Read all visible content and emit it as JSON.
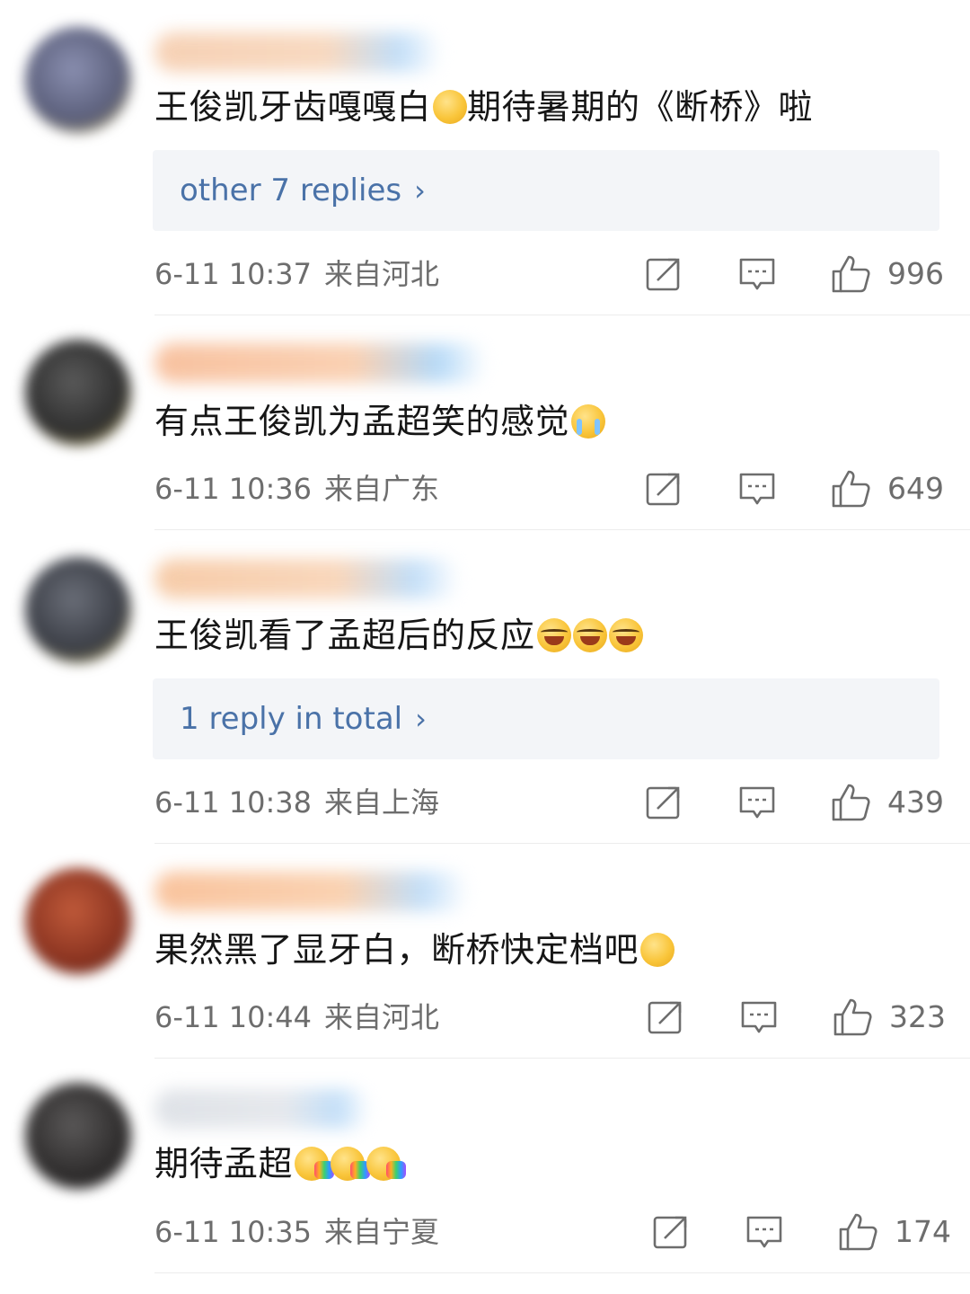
{
  "comments": [
    {
      "text": "王俊凯牙齿嘎嘎白",
      "text_after_emoji": "期待暑期的《断桥》啦",
      "emojis": [
        "thinking-face-emoji"
      ],
      "replies_label": "other 7 replies",
      "date": "6-11 10:37",
      "region": "来自河北",
      "likes": "996",
      "avatar_color": "#6b6f8e",
      "name_color": "#f5c9a8"
    },
    {
      "text": "有点王俊凯为孟超笑的感觉",
      "text_after_emoji": "",
      "emojis": [
        "loudly-crying-face-emoji"
      ],
      "replies_label": "",
      "date": "6-11 10:36",
      "region": "来自广东",
      "likes": "649",
      "avatar_color": "#3f3f3f",
      "name_color": "#f7b78f"
    },
    {
      "text": "王俊凯看了孟超后的反应",
      "text_after_emoji": "",
      "emojis": [
        "laughing-face-emoji",
        "laughing-face-emoji",
        "laughing-face-emoji"
      ],
      "replies_label": "1 reply in total",
      "date": "6-11 10:38",
      "region": "来自上海",
      "likes": "439",
      "avatar_color": "#4a4d55",
      "name_color": "#f5c39a"
    },
    {
      "text": "果然黑了显牙白，断桥快定档吧",
      "text_after_emoji": "",
      "emojis": [
        "smiling-hearts-face-emoji"
      ],
      "replies_label": "",
      "date": "6-11 10:44",
      "region": "来自河北",
      "likes": "323",
      "avatar_color": "#9a3a22",
      "name_color": "#f8b98c"
    },
    {
      "text": "期待孟超",
      "text_after_emoji": "",
      "emojis": [
        "rainbow-vomit-face-emoji",
        "rainbow-vomit-face-emoji",
        "rainbow-vomit-face-emoji"
      ],
      "replies_label": "",
      "date": "6-11 10:35",
      "region": "来自宁夏",
      "likes": "174",
      "avatar_color": "#3a3838",
      "name_color": "#d9dde3"
    }
  ],
  "icons": {
    "share": "share-icon",
    "comment": "comment-icon",
    "like": "thumbs-up-icon",
    "chevron": "chevron-right-icon"
  },
  "colors": {
    "link": "#4a72a8",
    "meta": "#6d6d6d",
    "replies_bg": "#f3f5f8",
    "name_blur_blue": "#b8d9f7"
  }
}
